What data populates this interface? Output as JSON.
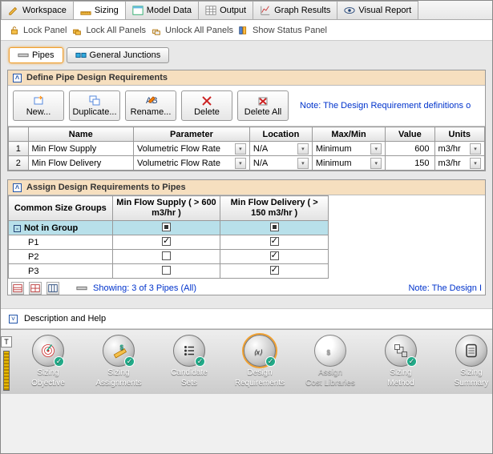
{
  "tabs": [
    "Workspace",
    "Sizing",
    "Model Data",
    "Output",
    "Graph Results",
    "Visual Report"
  ],
  "toolbar": {
    "lock": "Lock Panel",
    "lock_all": "Lock All Panels",
    "unlock_all": "Unlock All Panels",
    "status": "Show Status Panel"
  },
  "subtabs": {
    "pipes": "Pipes",
    "junctions": "General Junctions"
  },
  "panel1": {
    "title": "Define Pipe Design Requirements",
    "buttons": {
      "new": "New...",
      "dup": "Duplicate...",
      "ren": "Rename...",
      "del": "Delete",
      "del_all": "Delete All"
    },
    "note": "Note: The Design Requirement definitions o",
    "headers": [
      "Name",
      "Parameter",
      "Location",
      "Max/Min",
      "Value",
      "Units"
    ],
    "rows": [
      {
        "n": "1",
        "name": "Min Flow Supply",
        "param": "Volumetric Flow Rate",
        "loc": "N/A",
        "mm": "Minimum",
        "val": "600",
        "units": "m3/hr"
      },
      {
        "n": "2",
        "name": "Min Flow Delivery",
        "param": "Volumetric Flow Rate",
        "loc": "N/A",
        "mm": "Minimum",
        "val": "150",
        "units": "m3/hr"
      }
    ]
  },
  "panel2": {
    "title": "Assign Design Requirements to Pipes",
    "h1": "Common Size Groups",
    "h2": "Min Flow Supply ( > 600 m3/hr )",
    "h3": "Min Flow Delivery ( > 150 m3/hr )",
    "nig": "Not in Group",
    "rows": [
      {
        "name": "P1",
        "c1": "checked",
        "c2": "checked"
      },
      {
        "name": "P2",
        "c1": "",
        "c2": "checked"
      },
      {
        "name": "P3",
        "c1": "",
        "c2": "checked"
      }
    ],
    "status": "Showing: 3 of 3 Pipes (All)",
    "note2": "Note: The Design I"
  },
  "help": "Description and Help",
  "nav": [
    {
      "label1": "Sizing",
      "label2": "Objective",
      "ok": true
    },
    {
      "label1": "Sizing",
      "label2": "Assignments",
      "ok": true
    },
    {
      "label1": "Candidate",
      "label2": "Sets",
      "ok": true
    },
    {
      "label1": "Design",
      "label2": "Requirements",
      "ok": true,
      "current": true
    },
    {
      "label1": "Assign",
      "label2": "Cost Libraries",
      "ok": false,
      "disabled": true
    },
    {
      "label1": "Sizing",
      "label2": "Method",
      "ok": true
    },
    {
      "label1": "Sizing",
      "label2": "Summary",
      "ok": false
    }
  ]
}
